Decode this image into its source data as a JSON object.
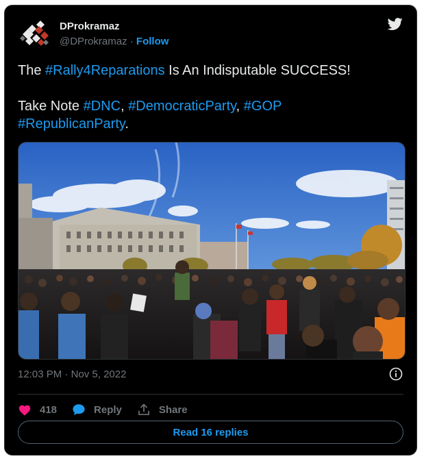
{
  "author": {
    "display_name": "DProkramaz",
    "handle": "@DProkramaz",
    "separator": "·",
    "follow_label": "Follow"
  },
  "tweet": {
    "line1_prefix": "The ",
    "line1_hashtag": "#Rally4Reparations",
    "line1_suffix": " Is An Indisputable SUCCESS!",
    "line2_prefix": "Take Note ",
    "hashtags2": [
      "#DNC",
      "#DemocraticParty",
      "#GOP",
      "#RepublicanParty"
    ],
    "sep_comma": ", ",
    "sep_space": " ",
    "end_period": "."
  },
  "meta": {
    "time": "12:03 PM",
    "date_sep": " · ",
    "date": "Nov 5, 2022"
  },
  "actions": {
    "like_count": "418",
    "reply_label": "Reply",
    "share_label": "Share"
  },
  "read_replies_label": "Read 16 replies",
  "colors": {
    "link": "#1d9bf0",
    "heart": "#f91880",
    "background": "#000000",
    "muted": "#71767b"
  },
  "icons": [
    "twitter-bird-icon",
    "heart-icon",
    "reply-bubble-icon",
    "share-icon",
    "info-icon"
  ]
}
